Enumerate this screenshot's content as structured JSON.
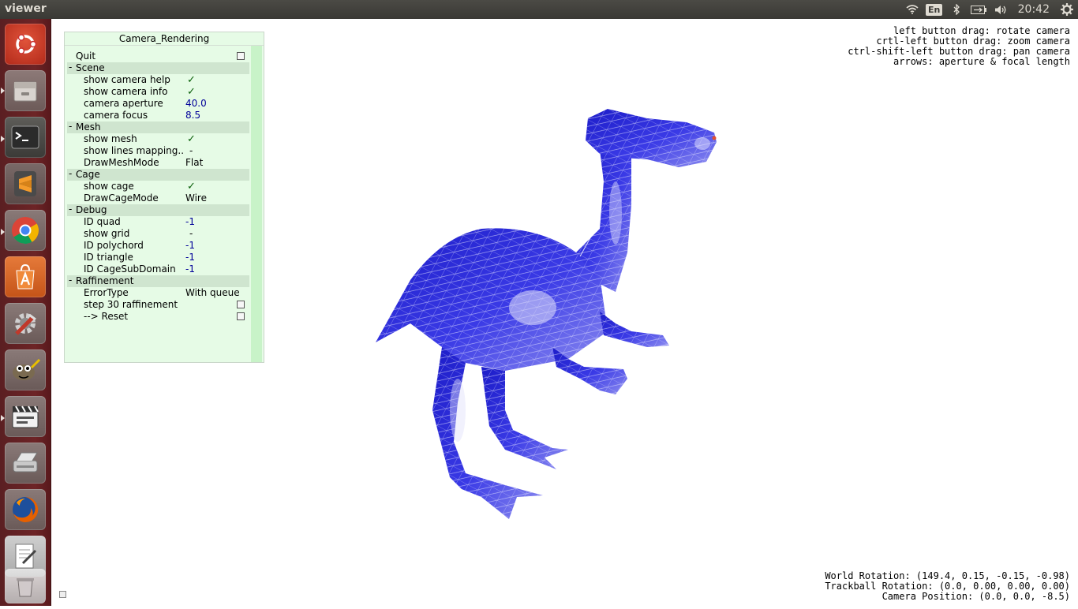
{
  "window": {
    "title": "viewer"
  },
  "tray": {
    "lang": "En",
    "clock": "20:42"
  },
  "panel": {
    "title": "Camera_Rendering",
    "quit": "Quit",
    "scene": {
      "label": "Scene",
      "show_camera_help": "show camera help",
      "show_camera_info": "show camera info",
      "camera_aperture": "camera aperture",
      "camera_aperture_value": "40.0",
      "camera_focus": "camera focus",
      "camera_focus_value": "8.5"
    },
    "mesh": {
      "label": "Mesh",
      "show_mesh": "show mesh",
      "show_lines_mapping": "show lines mapping..",
      "show_lines_mapping_value": "-",
      "draw_mesh_mode": "DrawMeshMode",
      "draw_mesh_mode_value": "Flat"
    },
    "cage": {
      "label": "Cage",
      "show_cage": "show cage",
      "draw_cage_mode": "DrawCageMode",
      "draw_cage_mode_value": "Wire"
    },
    "debug": {
      "label": "Debug",
      "id_quad": "ID quad",
      "id_quad_value": "-1",
      "show_grid": "show grid",
      "show_grid_value": "-",
      "id_polychord": "ID polychord",
      "id_polychord_value": "-1",
      "id_triangle": "ID triangle",
      "id_triangle_value": "-1",
      "id_cage_subdomain": "ID CageSubDomain",
      "id_cage_subdomain_value": "-1"
    },
    "raffinement": {
      "label": "Raffinement",
      "error_type": "ErrorType",
      "error_type_value": "With queue",
      "step": "step 30 raffinement",
      "reset": "--> Reset"
    },
    "check_glyph": "✓",
    "minus_glyph": "-"
  },
  "help": {
    "line1": "left button drag: rotate camera",
    "line2": "crtl-left button drag: zoom camera",
    "line3": "ctrl-shift-left button drag: pan camera",
    "line4": "arrows: aperture & focal length"
  },
  "info": {
    "world_rotation": "World Rotation: (149.4, 0.15, -0.15, -0.98)",
    "trackball_rotation": "Trackball Rotation: (0.0, 0.00, 0.00, 0.00)",
    "camera_position": "Camera Position: (0.0, 0.0, -8.5)"
  },
  "launcher": {
    "items": [
      "ubuntu-dash-icon",
      "files-icon",
      "terminal-icon",
      "sublime-text-icon",
      "chrome-icon",
      "software-center-icon",
      "system-settings-icon",
      "gimp-icon",
      "video-editor-icon",
      "scanner-icon",
      "firefox-icon",
      "text-editor-icon"
    ]
  },
  "colors": {
    "mesh": "#2a2ad6",
    "panel_bg": "#e6fbe6",
    "launcher": "#6d2426"
  }
}
